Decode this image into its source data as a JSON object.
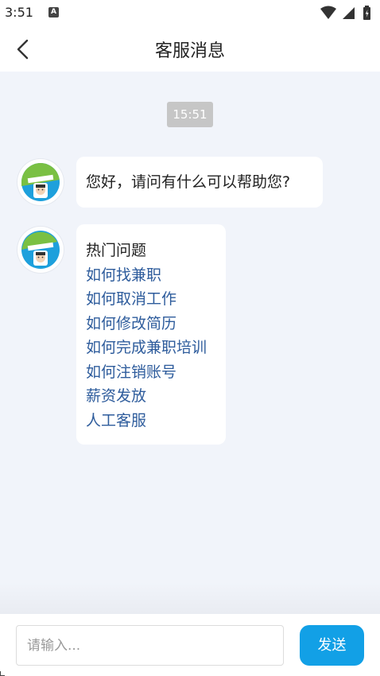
{
  "status_bar": {
    "time": "3:51",
    "notification_glyph": "A",
    "icons": [
      "wifi-icon",
      "cellular-signal-icon",
      "battery-charging-icon"
    ]
  },
  "header": {
    "back_icon": "chevron-left-icon",
    "title": "客服消息"
  },
  "chat": {
    "timestamp": "15:51",
    "messages": [
      {
        "sender": "agent",
        "avatar": "agent-avatar-icon",
        "text": "您好，请问有什么可以帮助您?"
      },
      {
        "sender": "agent",
        "avatar": "agent-avatar-icon",
        "title": "热门问题",
        "links": [
          "如何找兼职",
          "如何取消工作",
          "如何修改简历",
          "如何完成兼职培训",
          "如何注销账号",
          "薪资发放",
          "人工客服"
        ]
      }
    ]
  },
  "input_bar": {
    "placeholder": "请输入...",
    "value": "",
    "send_label": "发送"
  },
  "colors": {
    "chat_background": "#f1f4fa",
    "link": "#2e5c9c",
    "send_button": "#12a0e6",
    "timestamp_badge": "#c6c6c6"
  }
}
